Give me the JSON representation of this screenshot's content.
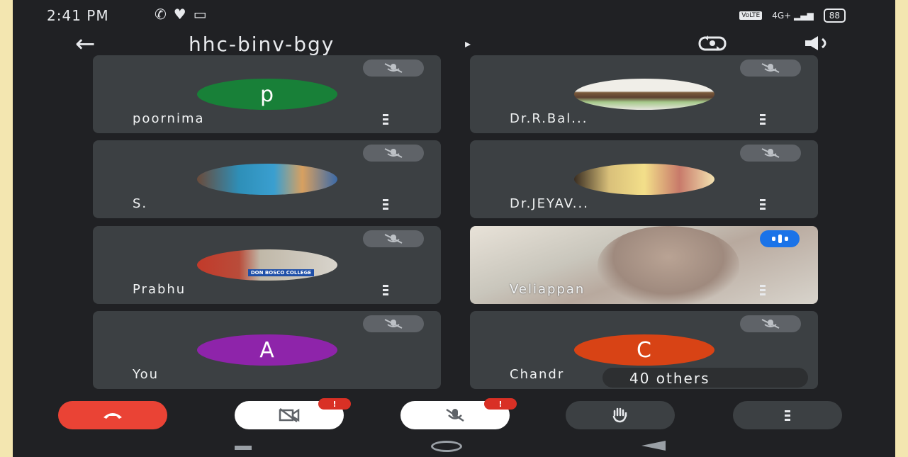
{
  "status_bar": {
    "time": "2:41 PM",
    "left_icons": [
      "whatsapp-icon",
      "heart-icon",
      "video-icon"
    ],
    "network": "4G+",
    "battery": "88"
  },
  "meeting": {
    "code": "hhc-binv-bgy"
  },
  "participants": [
    {
      "name": "poornima",
      "avatar_letter": "p",
      "avatar_color": "#188038",
      "muted": true
    },
    {
      "name": "Dr.R.Bal...",
      "avatar_letter": "",
      "avatar_color": "#e6e1d6",
      "muted": true
    },
    {
      "name": "S.",
      "avatar_letter": "",
      "avatar_color": "#2a6fb0",
      "muted": true
    },
    {
      "name": "Dr.JEYAV...",
      "avatar_letter": "",
      "avatar_color": "#e9d48a",
      "muted": true
    },
    {
      "name": "Prabhu",
      "avatar_letter": "",
      "avatar_color": "#b6b6b2",
      "muted": true,
      "avatar_banner": "DON BOSCO COLLEGE"
    },
    {
      "name": "Veliappan",
      "avatar_letter": "",
      "muted": false,
      "video_on": true,
      "speaking": true
    },
    {
      "name": "You",
      "avatar_letter": "A",
      "avatar_color": "#8e24aa",
      "muted": true
    },
    {
      "name": "Chandr",
      "avatar_letter": "C",
      "avatar_color": "#d84315",
      "muted": true
    }
  ],
  "others_label": "40 others",
  "controls": {
    "end_call": "end-call-icon",
    "camera": "camera-off-icon",
    "camera_badge": "!",
    "mic": "mic-off-icon",
    "mic_badge": "!",
    "raise_hand": "hand-icon",
    "more": "more-options-icon"
  },
  "colors": {
    "background": "#202124",
    "tile": "#3c4043",
    "end_call": "#ea4335",
    "speaking": "#1a73e8"
  }
}
